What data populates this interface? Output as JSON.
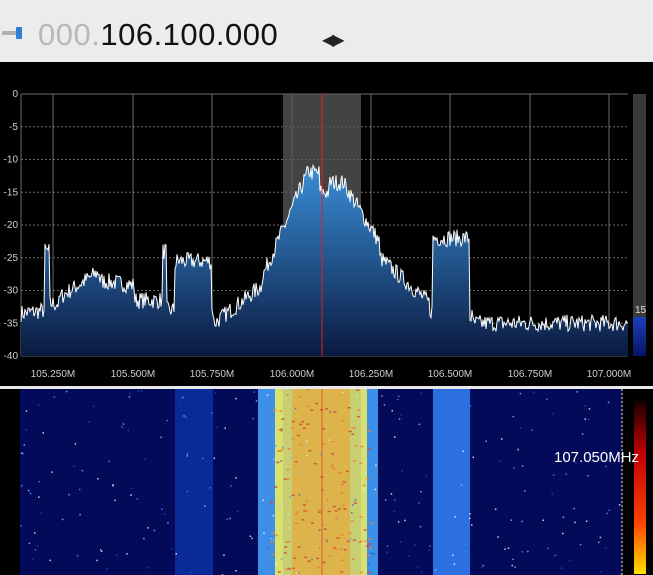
{
  "header": {
    "frequency_dim": "000.",
    "frequency_main": "106.100.000",
    "tune_arrows": "◀▶"
  },
  "spectrum": {
    "y_ticks": [
      "0",
      "-5",
      "-10",
      "-15",
      "-20",
      "-25",
      "-30",
      "-35",
      "-40"
    ],
    "x_ticks": [
      "105.250M",
      "105.500M",
      "105.750M",
      "106.000M",
      "106.250M",
      "106.500M",
      "106.750M",
      "107.000M"
    ],
    "level_value": "15"
  },
  "waterfall": {
    "cursor_frequency": "107.050MHz"
  },
  "colors": {
    "trace": "#ffffff",
    "center_line": "#e02020",
    "fill_top": "#3a8fd8",
    "fill_bottom": "#0a1a40",
    "grid": "#6a6a6a",
    "passband": "#5a5a5a"
  }
}
